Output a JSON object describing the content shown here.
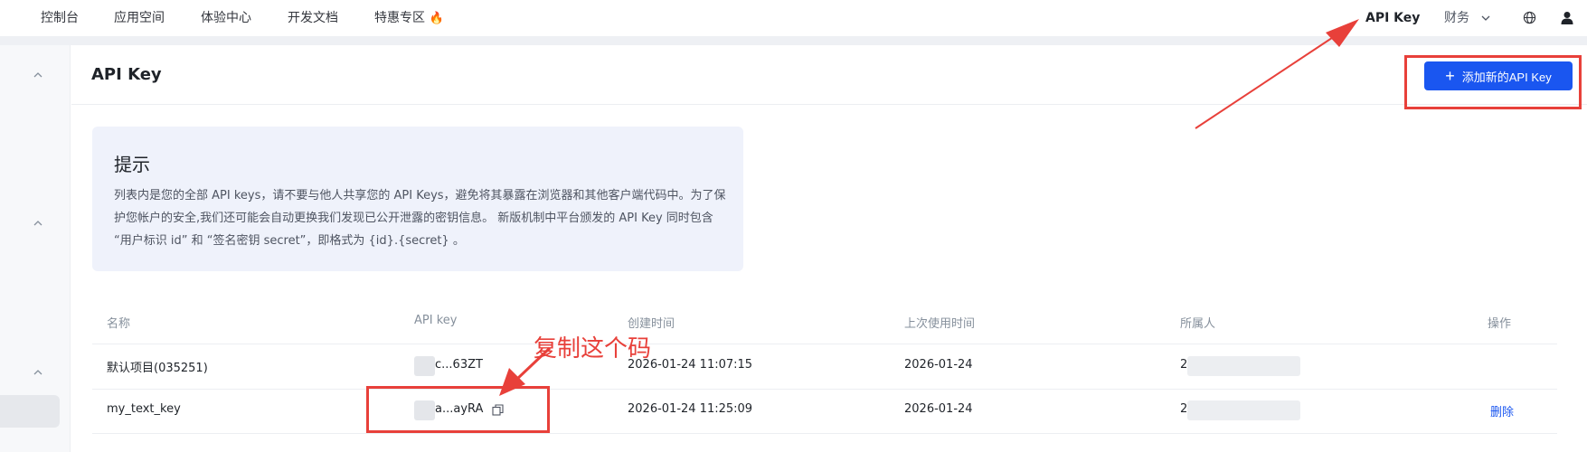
{
  "topnav": {
    "items": [
      "控制台",
      "应用空间",
      "体验中心",
      "开发文档",
      "特惠专区"
    ],
    "api_key": "API Key",
    "finance": "财务"
  },
  "page": {
    "title": "API Key",
    "add_button": "添加新的API Key"
  },
  "tip": {
    "title": "提示",
    "body": "列表内是您的全部 API keys，请不要与他人共享您的 API Keys，避免将其暴露在浏览器和其他客户端代码中。为了保护您帐户的安全,我们还可能会自动更换我们发现已公开泄露的密钥信息。 新版机制中平台颁发的 API Key 同时包含 “用户标识 id” 和 “签名密钥 secret”，即格式为 {id}.{secret} 。"
  },
  "table": {
    "headers": [
      "名称",
      "API key",
      "创建时间",
      "上次使用时间",
      "所属人",
      "操作"
    ],
    "rows": [
      {
        "name": "默认项目(035251)",
        "key": "c...63ZT",
        "created": "2026-01-24 11:07:15",
        "last_used": "2026-01-24",
        "owner": "2",
        "action": ""
      },
      {
        "name": "my_text_key",
        "key": "a...ayRA",
        "created": "2026-01-24 11:25:09",
        "last_used": "2026-01-24",
        "owner": "2",
        "action": "删除"
      }
    ]
  },
  "annotation": {
    "text": "复制这个码"
  },
  "colors": {
    "primary": "#1a56f0",
    "annotation": "#e8403a"
  }
}
